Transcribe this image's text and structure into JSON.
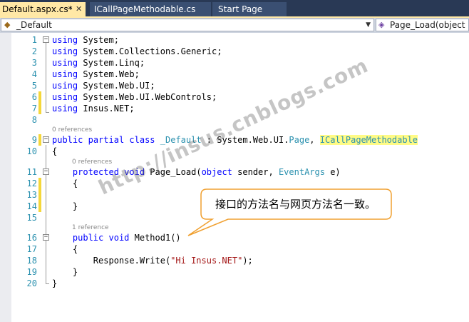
{
  "tabs": [
    {
      "label": "Default.aspx.cs*",
      "active": true
    },
    {
      "label": "ICallPageMethodable.cs",
      "active": false
    },
    {
      "label": "Start Page",
      "active": false
    }
  ],
  "nav": {
    "class_combo": "_Default",
    "member_combo": "Page_Load(object sen"
  },
  "code_lines": [
    {
      "n": "1",
      "text": "using System;"
    },
    {
      "n": "2",
      "text": "using System.Collections.Generic;"
    },
    {
      "n": "3",
      "text": "using System.Linq;"
    },
    {
      "n": "4",
      "text": "using System.Web;"
    },
    {
      "n": "5",
      "text": "using System.Web.UI;"
    },
    {
      "n": "6",
      "text": "using System.Web.UI.WebControls;"
    },
    {
      "n": "7",
      "text": "using Insus.NET;"
    },
    {
      "n": "8",
      "text": ""
    },
    {
      "n": "9",
      "text": "public partial class _Default : System.Web.UI.Page, ICallPageMethodable"
    },
    {
      "n": "10",
      "text": "{"
    },
    {
      "n": "11",
      "text": "protected void Page_Load(object sender, EventArgs e)"
    },
    {
      "n": "12",
      "text": "{"
    },
    {
      "n": "13",
      "text": ""
    },
    {
      "n": "14",
      "text": "}"
    },
    {
      "n": "15",
      "text": ""
    },
    {
      "n": "16",
      "text": "public void Method1()"
    },
    {
      "n": "17",
      "text": "{"
    },
    {
      "n": "18",
      "text": "Response.Write(\"Hi Insus.NET\");"
    },
    {
      "n": "19",
      "text": "}"
    },
    {
      "n": "20",
      "text": "}"
    }
  ],
  "lens": {
    "class_refs": "0 references",
    "page_load_refs": "0 references",
    "method1_refs": "1 reference"
  },
  "callout": "接口的方法名与网页方法名一致。",
  "watermark": "http://insus.cnblogs.com",
  "colors": {
    "keyword": "#0000ff",
    "type": "#2b91af",
    "string": "#a31515",
    "line_number": "#2b91af",
    "change_marker": "#f5d73a",
    "highlight": "#fffb85",
    "callout_border": "#f0a030",
    "active_tab": "#ffe8a6",
    "tabbar": "#293955"
  }
}
